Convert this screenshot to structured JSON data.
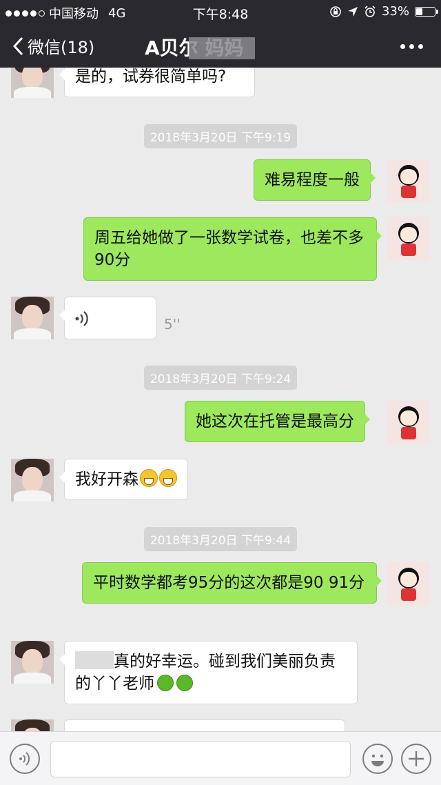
{
  "status_bar": {
    "carrier": "中国移动",
    "network": "4G",
    "time": "下午8:48",
    "battery_text": "33%",
    "battery_level": 0.33,
    "icons": [
      "orientation-lock-icon",
      "location-icon",
      "alarm-icon"
    ]
  },
  "nav": {
    "back_label": "微信(18)",
    "title": "A贝尔 妈妈",
    "more_icon": "more-dots-icon"
  },
  "messages": {
    "m1": {
      "text": "是的，试券很简单吗?"
    },
    "t1": {
      "text": "2018年3月20日 下午9:19"
    },
    "m2": {
      "text": "难易程度一般"
    },
    "m3": {
      "text": "周五给她做了一张数学试卷，也差不多90分"
    },
    "m4": {
      "voice_duration": "5''"
    },
    "t2": {
      "text": "2018年3月20日 下午9:24"
    },
    "m5": {
      "text": "她这次在托管是最高分"
    },
    "m6": {
      "text": "我好开森"
    },
    "t3": {
      "text": "2018年3月20日 下午9:44"
    },
    "m7": {
      "text": "平时数学都考95分的这次都是90  91分"
    },
    "m8": {
      "text_a": "真的好幸运。碰到我们美丽负责",
      "text_b": "的丫丫老师"
    }
  },
  "input_bar": {
    "voice_icon": "voice-input-icon",
    "emoji_icon": "emoji-icon",
    "add_icon": "plus-icon"
  },
  "colors": {
    "nav_bg": "#2a2a2e",
    "chat_bg": "#ebebeb",
    "sent_bubble": "#9de85d",
    "received_bubble": "#ffffff"
  }
}
